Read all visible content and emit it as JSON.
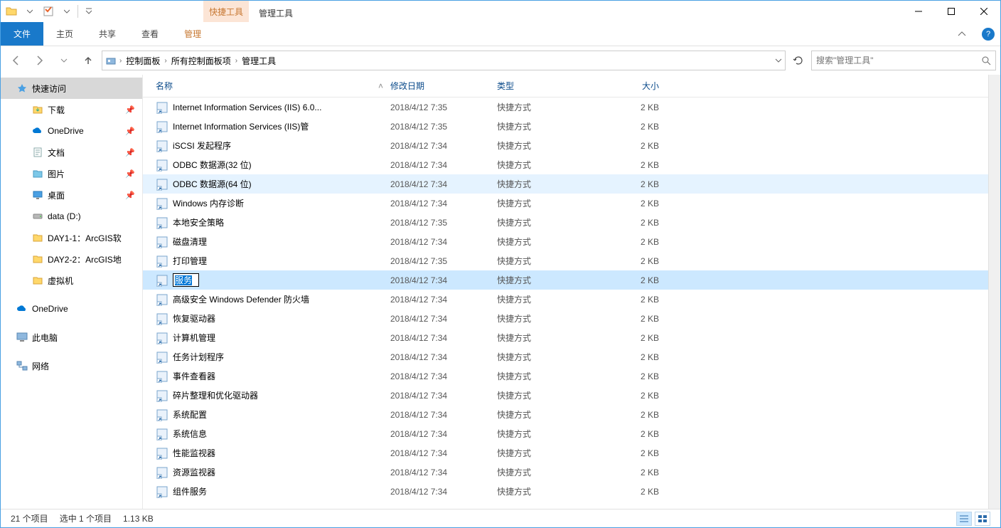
{
  "titlebar": {
    "context_tab": "快捷工具",
    "context_title": "管理工具"
  },
  "ribbon": {
    "file": "文件",
    "tabs": [
      "主页",
      "共享",
      "查看"
    ],
    "context_tab": "管理"
  },
  "breadcrumb": {
    "items": [
      "控制面板",
      "所有控制面板项",
      "管理工具"
    ]
  },
  "search": {
    "placeholder": "搜索\"管理工具\""
  },
  "sidebar": {
    "quick_access": "快速访问",
    "pinned": [
      {
        "label": "下载",
        "pin": true
      },
      {
        "label": "OneDrive",
        "pin": true
      },
      {
        "label": "文档",
        "pin": true
      },
      {
        "label": "图片",
        "pin": true
      },
      {
        "label": "桌面",
        "pin": true
      },
      {
        "label": "data (D:)",
        "pin": false
      },
      {
        "label": "DAY1-1：ArcGIS软",
        "pin": false
      },
      {
        "label": "DAY2-2：ArcGIS地",
        "pin": false
      },
      {
        "label": "虚拟机",
        "pin": false
      }
    ],
    "onedrive": "OneDrive",
    "thispc": "此电脑",
    "network": "网络"
  },
  "columns": {
    "name": "名称",
    "date": "修改日期",
    "type": "类型",
    "size": "大小"
  },
  "rows": [
    {
      "name": "Internet Information Services (IIS) 6.0...",
      "date": "2018/4/12 7:35",
      "type": "快捷方式",
      "size": "2 KB"
    },
    {
      "name": "Internet Information Services (IIS)管",
      "date": "2018/4/12 7:35",
      "type": "快捷方式",
      "size": "2 KB"
    },
    {
      "name": "iSCSI 发起程序",
      "date": "2018/4/12 7:34",
      "type": "快捷方式",
      "size": "2 KB"
    },
    {
      "name": "ODBC 数据源(32 位)",
      "date": "2018/4/12 7:34",
      "type": "快捷方式",
      "size": "2 KB"
    },
    {
      "name": "ODBC 数据源(64 位)",
      "date": "2018/4/12 7:34",
      "type": "快捷方式",
      "size": "2 KB",
      "state": "hover"
    },
    {
      "name": "Windows 内存诊断",
      "date": "2018/4/12 7:34",
      "type": "快捷方式",
      "size": "2 KB"
    },
    {
      "name": "本地安全策略",
      "date": "2018/4/12 7:35",
      "type": "快捷方式",
      "size": "2 KB"
    },
    {
      "name": "磁盘清理",
      "date": "2018/4/12 7:34",
      "type": "快捷方式",
      "size": "2 KB"
    },
    {
      "name": "打印管理",
      "date": "2018/4/12 7:35",
      "type": "快捷方式",
      "size": "2 KB"
    },
    {
      "name": "服务",
      "date": "2018/4/12 7:34",
      "type": "快捷方式",
      "size": "2 KB",
      "state": "selected",
      "rename": true
    },
    {
      "name": "高级安全 Windows Defender 防火墙",
      "date": "2018/4/12 7:34",
      "type": "快捷方式",
      "size": "2 KB"
    },
    {
      "name": "恢复驱动器",
      "date": "2018/4/12 7:34",
      "type": "快捷方式",
      "size": "2 KB"
    },
    {
      "name": "计算机管理",
      "date": "2018/4/12 7:34",
      "type": "快捷方式",
      "size": "2 KB"
    },
    {
      "name": "任务计划程序",
      "date": "2018/4/12 7:34",
      "type": "快捷方式",
      "size": "2 KB"
    },
    {
      "name": "事件查看器",
      "date": "2018/4/12 7:34",
      "type": "快捷方式",
      "size": "2 KB"
    },
    {
      "name": "碎片整理和优化驱动器",
      "date": "2018/4/12 7:34",
      "type": "快捷方式",
      "size": "2 KB"
    },
    {
      "name": "系统配置",
      "date": "2018/4/12 7:34",
      "type": "快捷方式",
      "size": "2 KB"
    },
    {
      "name": "系统信息",
      "date": "2018/4/12 7:34",
      "type": "快捷方式",
      "size": "2 KB"
    },
    {
      "name": "性能监视器",
      "date": "2018/4/12 7:34",
      "type": "快捷方式",
      "size": "2 KB"
    },
    {
      "name": "资源监视器",
      "date": "2018/4/12 7:34",
      "type": "快捷方式",
      "size": "2 KB"
    },
    {
      "name": "组件服务",
      "date": "2018/4/12 7:34",
      "type": "快捷方式",
      "size": "2 KB"
    }
  ],
  "status": {
    "count": "21 个项目",
    "selection": "选中 1 个项目",
    "size": "1.13 KB"
  }
}
